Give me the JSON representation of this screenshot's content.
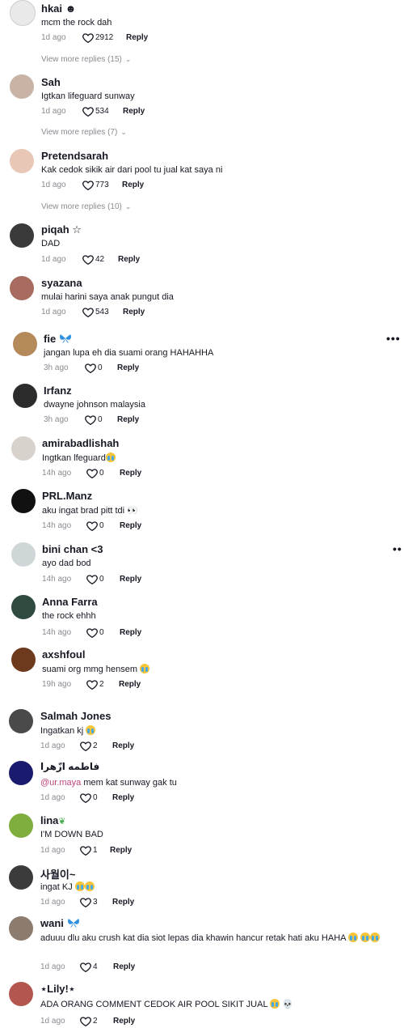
{
  "comments": [
    {
      "name": "hkai ☻",
      "text": "mcm the rock dah",
      "time": "1d ago",
      "likes": "2912",
      "reply": "Reply",
      "view_more": "View more replies (15)",
      "avatar_color": "#e9e9e9"
    },
    {
      "name": "Sah",
      "text": "Igtkan lifeguard sunway",
      "time": "1d ago",
      "likes": "534",
      "reply": "Reply",
      "view_more": "View more replies (7)",
      "avatar_color": "#c9b3a4"
    },
    {
      "name": "Pretendsarah",
      "text": "Kak cedok sikik air dari pool tu jual kat saya ni",
      "time": "1d ago",
      "likes": "773",
      "reply": "Reply",
      "view_more": "View more replies (10)",
      "avatar_color": "#e8c7b6"
    },
    {
      "name": "piqah ☆",
      "text": "DAD",
      "time": "1d ago",
      "likes": "42",
      "reply": "Reply",
      "avatar_color": "#3a3a3a"
    },
    {
      "name": "syazana",
      "text": "mulai harini saya anak pungut dia",
      "time": "1d ago",
      "likes": "543",
      "reply": "Reply",
      "avatar_color": "#a86b5f"
    },
    {
      "name": "fie",
      "text": "jangan lupa eh dia suami orang HAHAHHA",
      "time": "3h ago",
      "likes": "0",
      "reply": "Reply",
      "avatar_color": "#b58a5a"
    },
    {
      "name": "Irfanz",
      "text": "dwayne johnson malaysia",
      "time": "3h ago",
      "likes": "0",
      "reply": "Reply",
      "avatar_color": "#2c2c2c"
    },
    {
      "name": "amirabadlishah",
      "text": "Ingtkan lfeguard",
      "time": "14h ago",
      "likes": "0",
      "reply": "Reply",
      "avatar_color": "#d7d2cc"
    },
    {
      "name": "PRL.Manz",
      "text": "aku ingat brad pitt tdi",
      "time": "14h ago",
      "likes": "0",
      "reply": "Reply",
      "avatar_color": "#111111"
    },
    {
      "name": "bini chan <3",
      "text": "ayo dad bod",
      "time": "14h ago",
      "likes": "0",
      "reply": "Reply",
      "avatar_color": "#cfd6d8"
    },
    {
      "name": "Anna Farra",
      "text": "the rock ehhh",
      "time": "14h ago",
      "likes": "0",
      "reply": "Reply",
      "avatar_color": "#2f4a3e"
    },
    {
      "name": "axshfoul",
      "text": "suami org mmg hensem",
      "time": "19h ago",
      "likes": "2",
      "reply": "Reply",
      "avatar_color": "#6d3a1e"
    },
    {
      "name": "Salmah Jones",
      "text": "Ingatkan kj",
      "time": "1d ago",
      "likes": "2",
      "reply": "Reply",
      "avatar_color": "#4a4a4a"
    },
    {
      "name": "فاطمه ازّهرا",
      "mention": "@ur.maya",
      "text": " mem kat sunway gak tu",
      "time": "1d ago",
      "likes": "0",
      "reply": "Reply",
      "avatar_color": "#1a1a6e"
    },
    {
      "name": "lina",
      "text": "I'M DOWN BAD",
      "time": "1d ago",
      "likes": "1",
      "reply": "Reply",
      "avatar_color": "#7fae3e"
    },
    {
      "name": "사월이~",
      "text": "ingat KJ",
      "time": "1d ago",
      "likes": "3",
      "reply": "Reply",
      "avatar_color": "#3b3b3b"
    },
    {
      "name": "wani",
      "text": "aduuu dlu aku crush kat dia siot lepas dia khawin hancur retak hati aku HAHA",
      "time": "1d ago",
      "likes": "4",
      "reply": "Reply",
      "avatar_color": "#8c7b6f"
    },
    {
      "name": "⋆Lily!⋆",
      "text": "ADA ORANG COMMENT CEDOK AIR POOL SIKIT JUAL",
      "time": "1d ago",
      "likes": "2",
      "reply": "Reply",
      "avatar_color": "#b3564f"
    }
  ],
  "colors": {
    "text": "#161823",
    "muted": "#8a8b91",
    "mention": "#c0467c",
    "butterfly": "#2f8fe0"
  }
}
